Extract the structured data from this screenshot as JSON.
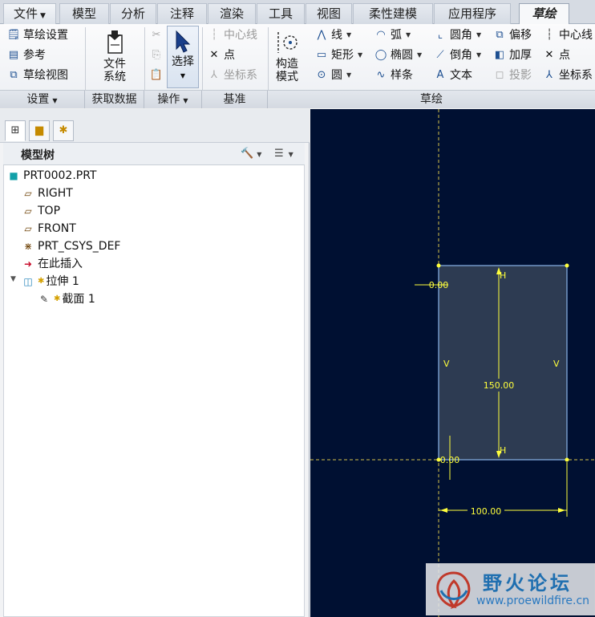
{
  "menu_tabs": [
    {
      "label": "文件",
      "has_dropdown": true
    },
    {
      "label": "模型"
    },
    {
      "label": "分析"
    },
    {
      "label": "注释"
    },
    {
      "label": "渲染"
    },
    {
      "label": "工具"
    },
    {
      "label": "视图"
    },
    {
      "label": "柔性建模"
    },
    {
      "label": "应用程序"
    },
    {
      "label": "草绘",
      "active": true
    }
  ],
  "ribbon": {
    "setup": {
      "sketch_setup": "草绘设置",
      "reference": "参考",
      "sketch_view": "草绘视图",
      "group_label": "设置"
    },
    "get_data": {
      "file_system": [
        "文件",
        "系统"
      ],
      "group_label": "获取数据"
    },
    "operations": {
      "select": "选择",
      "group_label": "操作"
    },
    "datum": {
      "centerline": "中心线",
      "point": "点",
      "coord_sys": "坐标系",
      "group_label": "基准"
    },
    "sketch": {
      "construction_mode": [
        "构造",
        "模式"
      ],
      "line": "线",
      "rectangle": "矩形",
      "circle": "圆",
      "arc": "弧",
      "ellipse": "椭圆",
      "spline": "样条",
      "fillet": "圆角",
      "chamfer": "倒角",
      "text": "文本",
      "offset": "偏移",
      "thicken": "加厚",
      "project": "投影",
      "centerline2": "中心线",
      "point2": "点",
      "coord_sys2": "坐标系",
      "group_label": "草绘"
    }
  },
  "model_tree": {
    "title": "模型树",
    "items": [
      {
        "label": "PRT0002.PRT",
        "icon": "part-icon"
      },
      {
        "label": "RIGHT",
        "icon": "datum-plane-icon"
      },
      {
        "label": "TOP",
        "icon": "datum-plane-icon"
      },
      {
        "label": "FRONT",
        "icon": "datum-plane-icon"
      },
      {
        "label": "PRT_CSYS_DEF",
        "icon": "csys-icon"
      },
      {
        "label": "在此插入",
        "icon": "insert-arrow-icon"
      },
      {
        "label": "拉伸 1",
        "icon": "extrude-icon"
      },
      {
        "label": "截面 1",
        "icon": "section-icon"
      }
    ]
  },
  "sketch": {
    "dim_height": "150.00",
    "dim_width": "100.00",
    "dim_origin_top": "0.00",
    "dim_origin_bottom": "0.00",
    "constraint_h": "H",
    "constraint_v": "V"
  },
  "watermark": {
    "title": "野火论坛",
    "url": "www.proewildfire.cn"
  },
  "colors": {
    "canvas_bg": "#001032",
    "sketch_yellow": "#ffff3c",
    "rect_fill": "#2d3b52",
    "rect_edge": "#8ab4e8"
  }
}
